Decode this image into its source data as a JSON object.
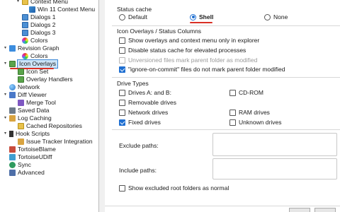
{
  "tree": {
    "items": [
      {
        "label": "Context Menu",
        "icon": "folder-icon"
      },
      {
        "label": "Win 11 Context Menu",
        "icon": "windows-icon"
      },
      {
        "label": "Dialogs 1",
        "icon": "dialog-icon"
      },
      {
        "label": "Dialogs 2",
        "icon": "dialog-icon"
      },
      {
        "label": "Dialogs 3",
        "icon": "dialog-icon"
      },
      {
        "label": "Colors",
        "icon": "color-palette-icon"
      },
      {
        "label": "Revision Graph",
        "icon": "revision-graph-icon"
      },
      {
        "label": "Colors",
        "icon": "color-palette-icon"
      },
      {
        "label": "Icon Overlays",
        "icon": "icon-overlays-icon"
      },
      {
        "label": "Icon Set",
        "icon": "icon-set-icon"
      },
      {
        "label": "Overlay Handlers",
        "icon": "overlay-handlers-icon"
      },
      {
        "label": "Network",
        "icon": "network-icon"
      },
      {
        "label": "Diff Viewer",
        "icon": "diff-viewer-icon"
      },
      {
        "label": "Merge Tool",
        "icon": "merge-tool-icon"
      },
      {
        "label": "Saved Data",
        "icon": "saved-data-icon"
      },
      {
        "label": "Log Caching",
        "icon": "log-caching-icon"
      },
      {
        "label": "Cached Repositories",
        "icon": "folder-icon"
      },
      {
        "label": "Hook Scripts",
        "icon": "hook-scripts-icon"
      },
      {
        "label": "Issue Tracker Integration",
        "icon": "issue-tracker-icon"
      },
      {
        "label": "TortoiseBlame",
        "icon": "tortoiseblame-icon"
      },
      {
        "label": "TortoiseUDiff",
        "icon": "tortoiseudiff-icon"
      },
      {
        "label": "Sync",
        "icon": "sync-icon"
      },
      {
        "label": "Advanced",
        "icon": "advanced-icon"
      }
    ],
    "selected": "Icon Overlays"
  },
  "status_cache": {
    "title": "Status cache",
    "options": [
      "Default",
      "Shell",
      "None"
    ],
    "selected": "Shell"
  },
  "overlays": {
    "title": "Icon Overlays / Status Columns",
    "checks": [
      {
        "label": "Show overlays and context menu only in explorer",
        "checked": false,
        "disabled": false
      },
      {
        "label": "Disable status cache for elevated processes",
        "checked": false,
        "disabled": false
      },
      {
        "label": "Unversioned files mark parent folder as modified",
        "checked": false,
        "disabled": true
      },
      {
        "label": "\"ignore-on-commit\" files do not mark parent folder modified",
        "checked": true,
        "disabled": false
      }
    ]
  },
  "drive_types": {
    "title": "Drive Types",
    "left": [
      {
        "label": "Drives A: and B:",
        "checked": false
      },
      {
        "label": "Removable drives",
        "checked": false
      },
      {
        "label": "Network drives",
        "checked": false
      },
      {
        "label": "Fixed drives",
        "checked": true
      }
    ],
    "right": [
      {
        "label": "CD-ROM",
        "checked": false
      },
      {
        "label": "RAM drives",
        "checked": false
      },
      {
        "label": "Unknown drives",
        "checked": false
      }
    ]
  },
  "paths": {
    "exclude_label": "Exclude paths:",
    "include_label": "Include paths:",
    "exclude_value": "",
    "include_value": ""
  },
  "show_excluded": {
    "label": "Show excluded root folders as normal",
    "checked": false
  },
  "colors": {
    "accent": "#1f6fd1",
    "selection": "#cce4f7",
    "annotation_red": "#d93025"
  }
}
